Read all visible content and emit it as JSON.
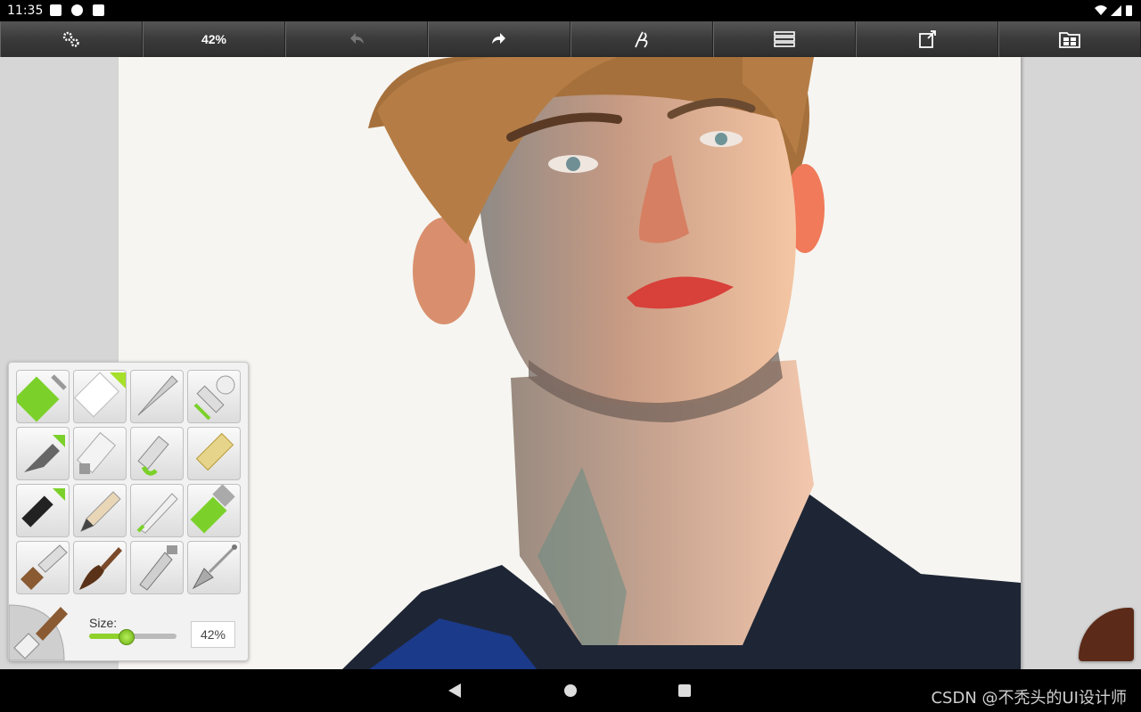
{
  "status_bar": {
    "time": "11:35"
  },
  "toolbar": {
    "zoom_label": "42%",
    "buttons": [
      "settings",
      "zoom",
      "undo",
      "redo",
      "brush-settings",
      "layers",
      "export",
      "gallery"
    ]
  },
  "tools": {
    "grid": [
      {
        "name": "paint-roller"
      },
      {
        "name": "eraser"
      },
      {
        "name": "palette-knife"
      },
      {
        "name": "stamp"
      },
      {
        "name": "airbrush"
      },
      {
        "name": "paint-tube"
      },
      {
        "name": "glitter-tube"
      },
      {
        "name": "glitter"
      },
      {
        "name": "ink-pen"
      },
      {
        "name": "pencil"
      },
      {
        "name": "felt-pen"
      },
      {
        "name": "crayon"
      },
      {
        "name": "flat-brush"
      },
      {
        "name": "round-brush"
      },
      {
        "name": "fill"
      },
      {
        "name": "spatula"
      }
    ],
    "size_label": "Size:",
    "size_value": "42%",
    "size_fraction": 0.42
  },
  "color_picker": {
    "current_color": "#5c2a18"
  },
  "watermark": "CSDN @不秃头的UI设计师"
}
